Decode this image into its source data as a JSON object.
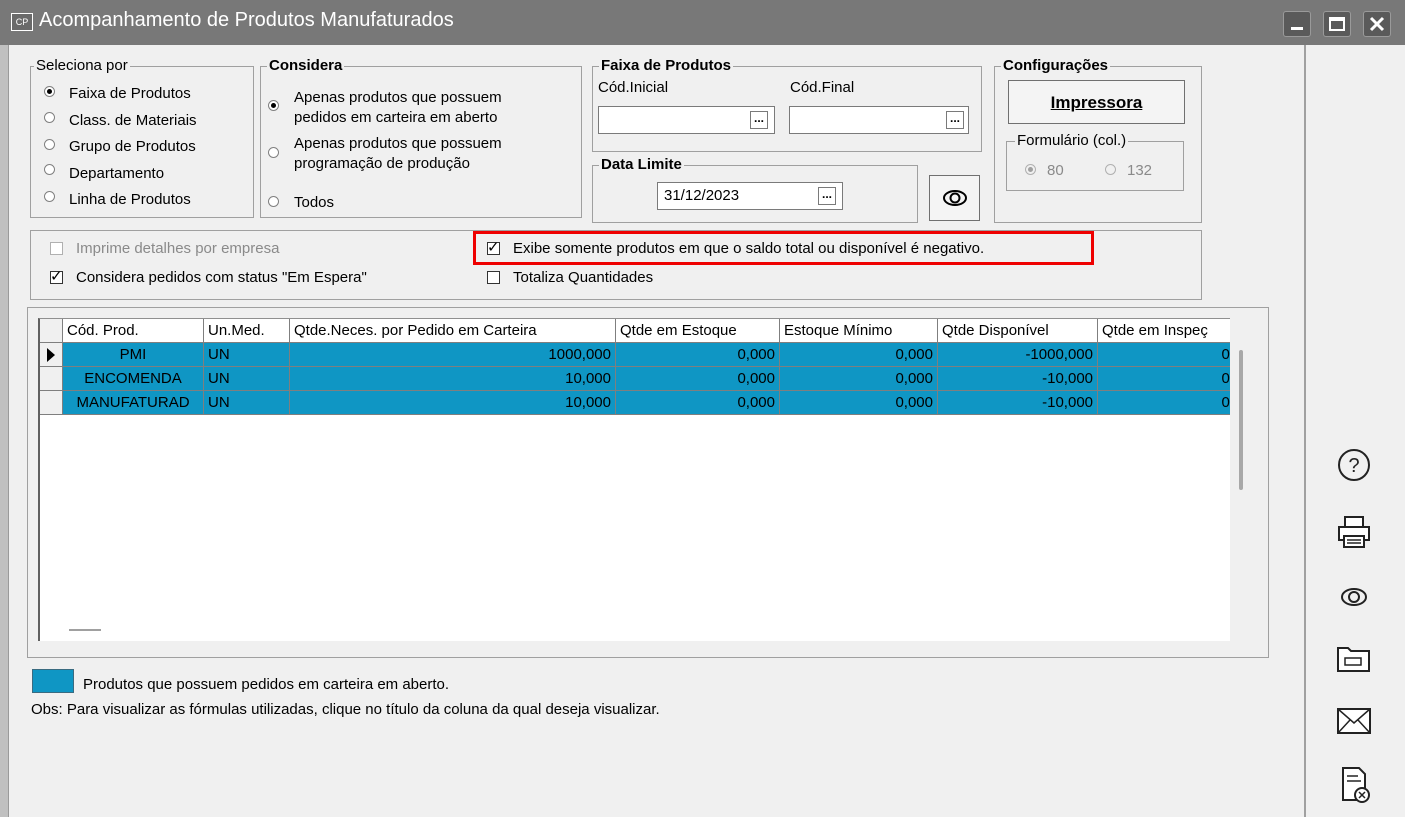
{
  "window": {
    "icon_text": "CP",
    "title": "Acompanhamento de Produtos Manufaturados"
  },
  "seleciona": {
    "legend": "Seleciona por",
    "options": [
      "Faixa de Produtos",
      "Class. de Materiais",
      "Grupo de Produtos",
      "Departamento",
      "Linha de Produtos"
    ],
    "selected_index": 0
  },
  "considera": {
    "legend": "Considera",
    "opt1_line1": "Apenas produtos que possuem",
    "opt1_line2": "pedidos em carteira em aberto",
    "opt2_line1": "Apenas produtos que possuem",
    "opt2_line2": "programação de produção",
    "opt3": "Todos",
    "selected_index": 0
  },
  "faixa": {
    "legend": "Faixa de Produtos",
    "cod_inicial_label": "Cód.Inicial",
    "cod_final_label": "Cód.Final",
    "cod_inicial_value": "",
    "cod_final_value": "",
    "ellipsis": "..."
  },
  "data_limite": {
    "legend": "Data Limite",
    "value": "31/12/2023"
  },
  "config": {
    "legend": "Configurações",
    "impressora_label": "Impressora",
    "formulario_legend": "Formulário (col.)",
    "col80": "80",
    "col132": "132"
  },
  "options": {
    "imprime_detalhes": "Imprime detalhes por empresa",
    "considera_espera": "Considera pedidos com status \"Em Espera\"",
    "exibe_negativo": "Exibe somente produtos em que o saldo total ou disponível é negativo.",
    "totaliza": "Totaliza Quantidades"
  },
  "grid": {
    "columns": [
      "Cód. Prod.",
      "Un.Med.",
      "Qtde.Neces. por Pedido em Carteira",
      "Qtde em Estoque",
      "Estoque Mínimo",
      "Qtde Disponível",
      "Qtde em Inspeç"
    ],
    "rows": [
      [
        "PMI",
        "UN",
        "1000,000",
        "0,000",
        "0,000",
        "-1000,000",
        "0,"
      ],
      [
        "ENCOMENDA",
        "UN",
        "10,000",
        "0,000",
        "0,000",
        "-10,000",
        "0,"
      ],
      [
        "MANUFATURAD",
        "UN",
        "10,000",
        "0,000",
        "0,000",
        "-10,000",
        "0,"
      ]
    ],
    "row_color": "#0f96c4"
  },
  "legend_note": {
    "swatch_text": "Produtos que possuem pedidos em carteira em aberto.",
    "obs": "Obs: Para visualizar as fórmulas utilizadas, clique no título da coluna da qual deseja visualizar."
  },
  "side_icons": [
    "help-icon",
    "printer-icon",
    "view-icon",
    "folder-icon",
    "email-icon",
    "close-document-icon"
  ]
}
